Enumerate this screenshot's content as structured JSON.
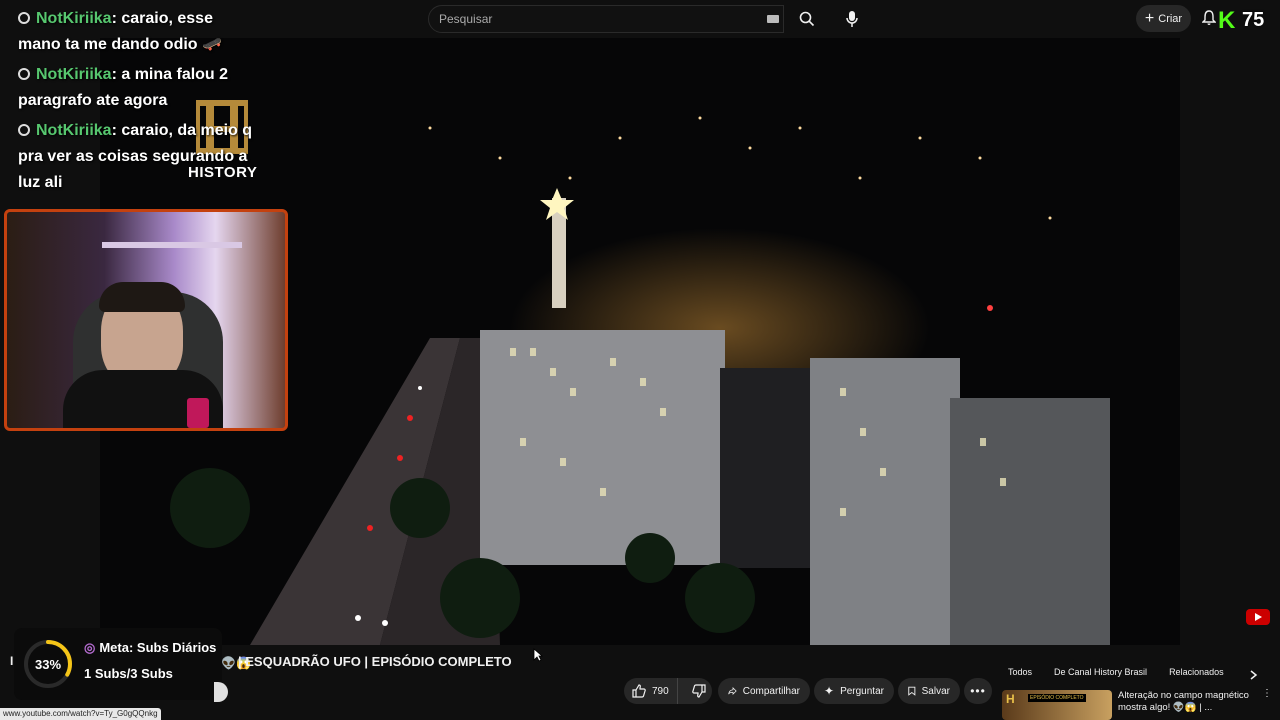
{
  "header": {
    "search_placeholder": "Pesquisar",
    "create_label": "Criar",
    "kick_logo_letter": "K",
    "kick_count": "75"
  },
  "chat": {
    "messages": [
      {
        "user": "NotKiriika",
        "text": ": caraio, esse mano ta me dando odio 🛹"
      },
      {
        "user": "NotKiriika",
        "text": ": a mina falou 2 paragrafo ate agora"
      },
      {
        "user": "NotKiriika",
        "text": ": caraio, da meio q pra ver as coisas segurando a luz ali"
      }
    ]
  },
  "video": {
    "channel_logo_text": "HISTORY",
    "title": "| ESQUADRÃO UFO | EPISÓDIO COMPLETO",
    "title_prefix_letter": "I",
    "title_emojis": "👽😱"
  },
  "goal_widget": {
    "percent": 33,
    "percent_label": "33%",
    "title": "Meta: Subs Diários",
    "count": "1 Subs/3 Subs",
    "accent_color": "#f5c518"
  },
  "actions": {
    "likes": "790",
    "share": "Compartilhar",
    "ask": "Perguntar",
    "save": "Salvar"
  },
  "chips": [
    "Todos",
    "De Canal History Brasil",
    "Relacionados"
  ],
  "recommendation": {
    "thumb_letter": "H",
    "thumb_badge": "EPISÓDIO COMPLETO",
    "title": "Alteração no campo magnético mostra algo! 👽😱 | ..."
  },
  "status_bar": {
    "url": "www.youtube.com/watch?v=Ty_G0gQQnkg"
  },
  "colors": {
    "chat_username": "#57c76f",
    "kick_green": "#53fc18",
    "webcam_border": "#c4410f"
  }
}
